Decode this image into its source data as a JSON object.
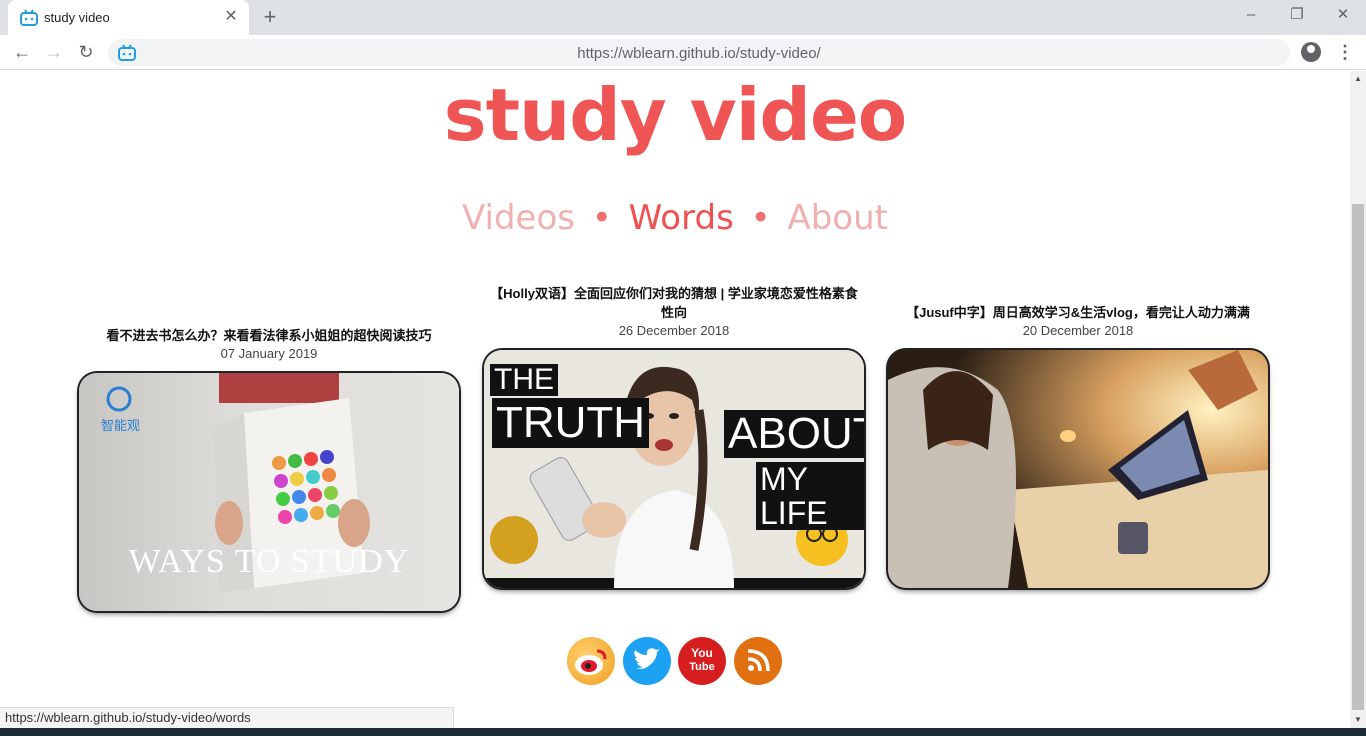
{
  "browser": {
    "tab_title": "study video",
    "new_tab": "+",
    "tab_close": "✕",
    "url_display": "https://wblearn.github.io/study-video/",
    "status_url": "https://wblearn.github.io/study-video/words",
    "window_controls": [
      "–",
      "❐",
      "✕"
    ],
    "nav": {
      "back": "←",
      "forward": "→",
      "reload": "↻",
      "menu": "⋮"
    }
  },
  "site": {
    "title": "study video",
    "nav": [
      {
        "label": "Videos",
        "active": false
      },
      {
        "label": "Words",
        "active": true
      },
      {
        "label": "About",
        "active": false
      }
    ],
    "separator": "•"
  },
  "videos": [
    {
      "title": "看不进去书怎么办？来看看法律系小姐姐的超快阅读技巧",
      "date": "07 January 2019",
      "thumb_text": "WAYS TO STUDY",
      "thumb_logo": "智能观"
    },
    {
      "title": "【Holly双语】全面回应你们对我的猜想 | 学业家境恋爱性格素食性向",
      "date": "26 December 2018",
      "thumb_text_1": "THE",
      "thumb_text_2": "TRUTH",
      "thumb_text_3": "ABOUT",
      "thumb_text_4": "MY LIFE"
    },
    {
      "title": "【Jusuf中字】周日高效学习&生活vlog，看完让人动力满满",
      "date": "20 December 2018"
    }
  ],
  "social": [
    {
      "name": "weibo",
      "color": "#e6162d"
    },
    {
      "name": "twitter",
      "color": "#1da1f2"
    },
    {
      "name": "youtube",
      "color": "#d71e1e",
      "label_top": "You",
      "label_bottom": "Tube"
    },
    {
      "name": "rss",
      "color": "#e07010"
    }
  ]
}
